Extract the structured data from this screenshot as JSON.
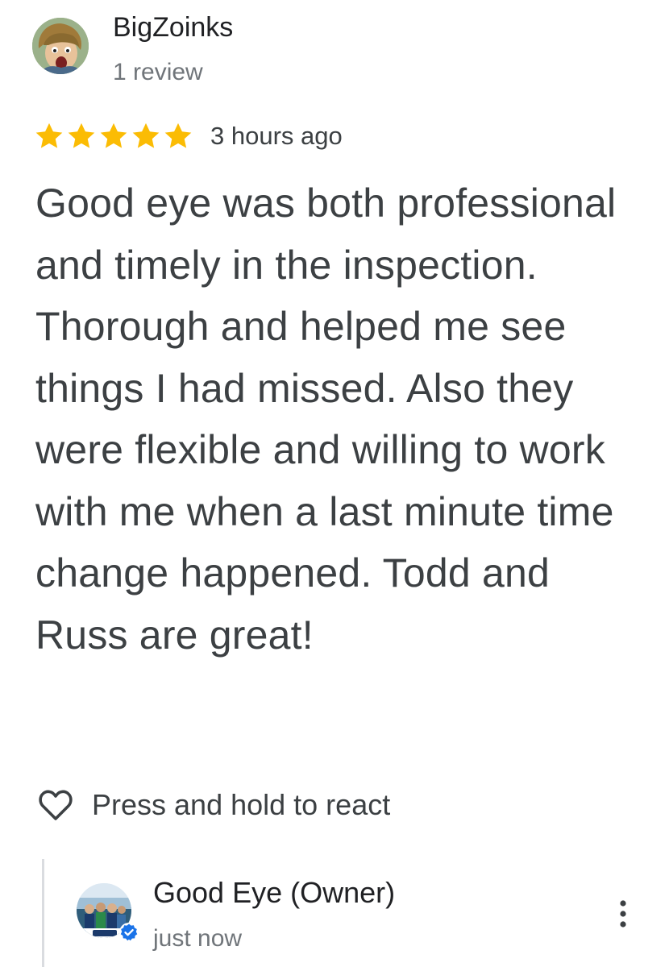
{
  "reviewer": {
    "name": "BigZoinks",
    "review_count": "1 review",
    "avatar_icon": "cartoon-avatar"
  },
  "rating": {
    "stars": 5,
    "max_stars": 5,
    "star_color": "#fbbc04"
  },
  "time_ago": "3 hours ago",
  "review_text": "Good eye was both professional and timely in the inspection. Thorough and helped me see things I had missed. Also they were flexible and willing to work with me when a last minute time change happened. Todd and Russ are great!",
  "react": {
    "label": "Press and hold to react",
    "icon": "heart-outline-icon"
  },
  "owner_reply": {
    "name": "Good Eye (Owner)",
    "time": "just now",
    "avatar_icon": "business-logo",
    "verified_icon": "verified-badge-icon",
    "verified_color": "#1a73e8",
    "menu_icon": "more-vert-icon"
  }
}
